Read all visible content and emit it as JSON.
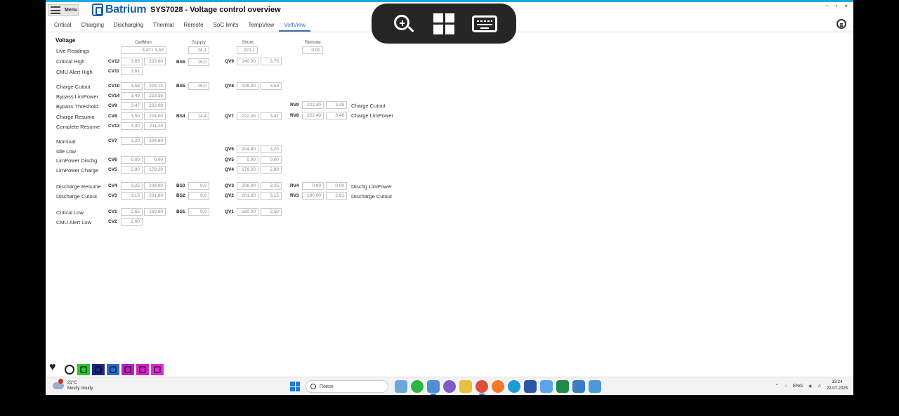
{
  "titlebar": {
    "menu_label": "Menu",
    "logo_text": "Batrium",
    "window_title": "SYS7028 - Voltage control overview",
    "win_controls": [
      "–",
      "▫",
      "×"
    ]
  },
  "tabs": [
    "Critical",
    "Charging",
    "Discharging",
    "Thermal",
    "Remote",
    "SoC limits",
    "TempView",
    "VoltView"
  ],
  "active_tab": "VoltView",
  "section_title": "Voltage",
  "column_headers": {
    "cellmon": "CellMon",
    "supply": "Supply",
    "shunt": "Shunt",
    "remote": "Remote"
  },
  "live_readings": {
    "label": "Live Readings",
    "cellmon": "3,47 / 3,63",
    "supply": "24,1",
    "shunt": "223,1",
    "remote": "0,00"
  },
  "row_labels": {
    "critical_high": "Critical High",
    "cmu_alert_high": "CMU Alert High",
    "charge_cutout": "Charge Cutout",
    "bypass_limpower": "Bypass LimPower",
    "bypass_threshold": "Bypass  Threshold",
    "charge_resume": "Charge Resume",
    "complete_resume": "Complete Resume",
    "nominal": "Nominal",
    "idle_low": "Idle Low",
    "limpower_dischg": "LimPower Dischg",
    "limpower_charge": "LimPower Charge",
    "discharge_resume": "Discharge Resume",
    "discharge_cutout": "Discharge Cutout",
    "critical_low": "Critical Low",
    "cmu_alert_low": "CMU Alert Low"
  },
  "cv": {
    "cv12": {
      "code": "CV12",
      "a": "3,65",
      "b": "233,60"
    },
    "cv11": {
      "code": "CV11",
      "a": "3,61"
    },
    "cv10": {
      "code": "CV10",
      "a": "3,58",
      "b": "229,12"
    },
    "cv14": {
      "code": "CV14",
      "a": "3,49",
      "b": "223,36"
    },
    "cv9": {
      "code": "CV9",
      "a": "3,47",
      "b": "222,08"
    },
    "cv8": {
      "code": "CV8",
      "a": "3,50",
      "b": "224,00"
    },
    "cv13": {
      "code": "CV13",
      "a": "3,30",
      "b": "211,20"
    },
    "cv7": {
      "code": "CV7",
      "a": "3,20",
      "b": "204,80"
    },
    "cv6": {
      "code": "CV6",
      "a": "0,00",
      "b": "0,00"
    },
    "cv5": {
      "code": "CV5",
      "a": "2,80",
      "b": "179,20"
    },
    "cv4": {
      "code": "CV4",
      "a": "3,25",
      "b": "208,00"
    },
    "cv3": {
      "code": "CV3",
      "a": "3,15",
      "b": "201,60"
    },
    "cv1": {
      "code": "CV1",
      "a": "2,65",
      "b": "169,60"
    },
    "cv2": {
      "code": "CV2",
      "a": "2,60"
    }
  },
  "bs": {
    "bs6": {
      "code": "BS6",
      "v": "16,0"
    },
    "bs5": {
      "code": "BS5",
      "v": "16,0"
    },
    "bs4": {
      "code": "BS4",
      "v": "14,4"
    },
    "bs3": {
      "code": "BS3",
      "v": "9,0"
    },
    "bs2": {
      "code": "BS2",
      "v": "9,0"
    },
    "bs1": {
      "code": "BS1",
      "v": "9,0"
    }
  },
  "qv": {
    "qv9": {
      "code": "QV9",
      "a": "240,00",
      "b": "3,75"
    },
    "qv8": {
      "code": "QV8",
      "a": "226,00",
      "b": "3,53"
    },
    "qv7": {
      "code": "QV7",
      "a": "222,00",
      "b": "3,47"
    },
    "qv6": {
      "code": "QV6",
      "a": "204,80",
      "b": "3,20"
    },
    "qv5": {
      "code": "QV5",
      "a": "0,00",
      "b": "0,00"
    },
    "qv4": {
      "code": "QV4",
      "a": "179,20",
      "b": "2,80"
    },
    "qv3": {
      "code": "QV3",
      "a": "208,00",
      "b": "3,25"
    },
    "qv2": {
      "code": "QV2",
      "a": "201,60",
      "b": "3,15"
    },
    "qv1": {
      "code": "QV1",
      "a": "160,00",
      "b": "2,50"
    }
  },
  "rv": {
    "rv9": {
      "code": "RV9",
      "a": "222,40",
      "b": "3,48",
      "note": "Charge Cutout"
    },
    "rv8": {
      "code": "RV8",
      "a": "222,40",
      "b": "3,48",
      "note": "Charge LimPower"
    },
    "rv4": {
      "code": "RV4",
      "a": "0,00",
      "b": "0,00",
      "note": "Dischg LimPower"
    },
    "rv3": {
      "code": "RV3",
      "a": "180,00",
      "b": "2,81",
      "note": "Discharge Cutout"
    }
  },
  "status_icons": [
    "heart-icon",
    "gauge-icon",
    "run-icon",
    "cell-icon",
    "battery-icon",
    "fan-icon",
    "tools-icon",
    "load-icon"
  ],
  "taskbar": {
    "weather_temp": "21°C",
    "weather_desc": "Mostly cloudy",
    "search_placeholder": "Поиск",
    "lang": "ENG",
    "time": "13:24",
    "date": "22.07.2025"
  },
  "colors": {
    "accent": "#19a8e0",
    "logo": "#1a5fa8",
    "active_tab": "#3a6fb0",
    "overlay": "#262626"
  }
}
